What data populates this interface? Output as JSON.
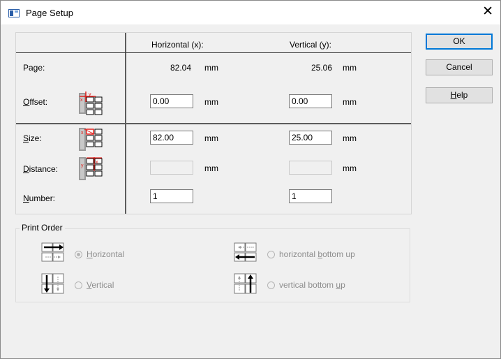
{
  "window": {
    "title": "Page Setup",
    "close_glyph": "✕"
  },
  "grid": {
    "col_horizontal": "Horizontal (x):",
    "col_vertical": "Vertical (y):",
    "rows": {
      "page": {
        "label": "Page:",
        "h_value": "82.04",
        "v_value": "25.06",
        "unit": "mm"
      },
      "offset": {
        "label_prefix": "",
        "label_u": "O",
        "label_rest": "ffset:",
        "h_value": "0.00",
        "v_value": "0.00",
        "unit": "mm"
      },
      "size": {
        "label_u": "S",
        "label_rest": "ize:",
        "h_value": "82.00",
        "v_value": "25.00",
        "unit": "mm"
      },
      "distance": {
        "label_u": "D",
        "label_rest": "istance:",
        "h_value": "",
        "v_value": "",
        "unit": "mm"
      },
      "number": {
        "label_u": "N",
        "label_rest": "umber:",
        "h_value": "1",
        "v_value": "1"
      }
    }
  },
  "buttons": {
    "ok": "OK",
    "cancel": "Cancel",
    "help_u": "H",
    "help_rest": "elp"
  },
  "print_order": {
    "title": "Print Order",
    "options": [
      {
        "pre": "",
        "u": "H",
        "post": "orizontal",
        "selected": true
      },
      {
        "pre": "",
        "u": "V",
        "post": "ertical",
        "selected": false
      },
      {
        "pre": "horizontal ",
        "u": "b",
        "post": "ottom up",
        "selected": false
      },
      {
        "pre": "vertical bottom ",
        "u": "u",
        "post": "p",
        "selected": false
      }
    ]
  },
  "colors": {
    "accent": "#0078d7",
    "label_red": "#e0201c",
    "disabled_text": "#8d8d8d"
  },
  "icons": [
    "page-setup-icon",
    "close-icon",
    "offset-icon",
    "size-icon",
    "distance-icon",
    "order-horizontal-icon",
    "order-vertical-icon",
    "order-horizontal-bottom-up-icon",
    "order-vertical-bottom-up-icon"
  ]
}
